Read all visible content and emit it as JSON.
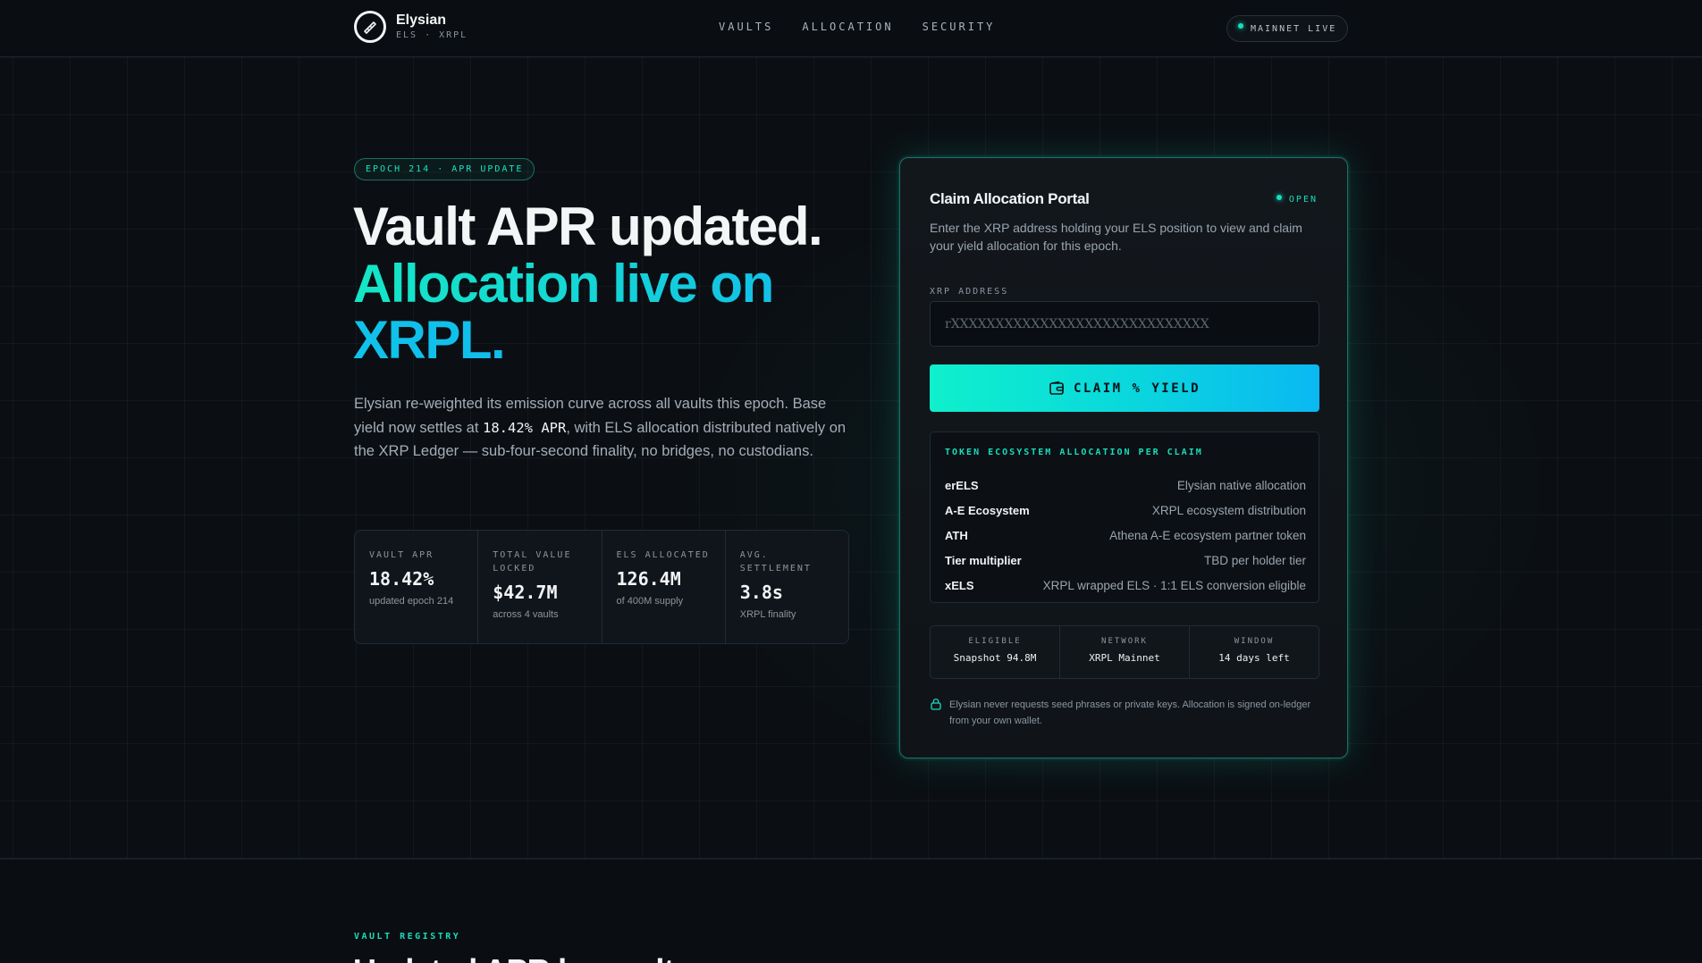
{
  "header": {
    "brand_name": "Elysian",
    "brand_sub": "ELS · XRPL",
    "nav": [
      "VAULTS",
      "ALLOCATION",
      "SECURITY"
    ],
    "status": "MAINNET LIVE"
  },
  "hero": {
    "epoch_badge": "EPOCH 214 · APR UPDATE",
    "title_line1": "Vault APR updated.",
    "title_line2": "Allocation live on",
    "title_line3": "XRPL.",
    "desc_part1": "Elysian re-weighted its emission curve across all vaults this epoch. Base yield now settles at ",
    "desc_highlight": "18.42% APR",
    "desc_part2": ", with ELS allocation distributed natively on the XRP Ledger — sub-four-second finality, no bridges, no custodians."
  },
  "stats": [
    {
      "label": "VAULT APR",
      "value": "18.42%",
      "sub": "updated epoch 214"
    },
    {
      "label": "TOTAL VALUE LOCKED",
      "value": "$42.7M",
      "sub": "across 4 vaults"
    },
    {
      "label": "ELS ALLOCATED",
      "value": "126.4M",
      "sub": "of 400M supply"
    },
    {
      "label": "AVG. SETTLEMENT",
      "value": "3.8s",
      "sub": "XRPL finality"
    }
  ],
  "card": {
    "title": "Claim Allocation Portal",
    "status": "OPEN",
    "desc": "Enter the XRP address holding your ELS position to view and claim your yield allocation for this epoch.",
    "field_label": "XRP ADDRESS",
    "field_placeholder": "rXXXXXXXXXXXXXXXXXXXXXXXXXXXXX",
    "field_value": "",
    "button_label": "CLAIM % YIELD",
    "alloc_heading": "TOKEN ECOSYSTEM ALLOCATION PER CLAIM",
    "alloc_rows": [
      {
        "name": "erELS",
        "desc": "Elysian native allocation"
      },
      {
        "name": "A-E Ecosystem",
        "desc": "XRPL ecosystem distribution"
      },
      {
        "name": "ATH",
        "desc": "Athena A-E ecosystem partner token"
      },
      {
        "name": "Tier multiplier",
        "desc": "TBD per holder tier"
      },
      {
        "name": "xELS",
        "desc": "XRPL wrapped ELS · 1:1 ELS conversion eligible"
      }
    ],
    "meta": [
      {
        "label": "ELIGIBLE",
        "value": "Snapshot 94.8M"
      },
      {
        "label": "NETWORK",
        "value": "XRPL Mainnet"
      },
      {
        "label": "WINDOW",
        "value": "14 days left"
      }
    ],
    "notice": "Elysian never requests seed phrases or private keys. Allocation is signed on-ledger from your own wallet."
  },
  "registry": {
    "label": "VAULT REGISTRY",
    "title": "Updated APR by vault"
  },
  "colors": {
    "accent": "#14e0c0",
    "accent_blue": "#12b5f0",
    "background": "#0a0d11"
  },
  "icons": [
    "logo-icon",
    "status-dot-icon",
    "wallet-icon",
    "lock-icon"
  ]
}
